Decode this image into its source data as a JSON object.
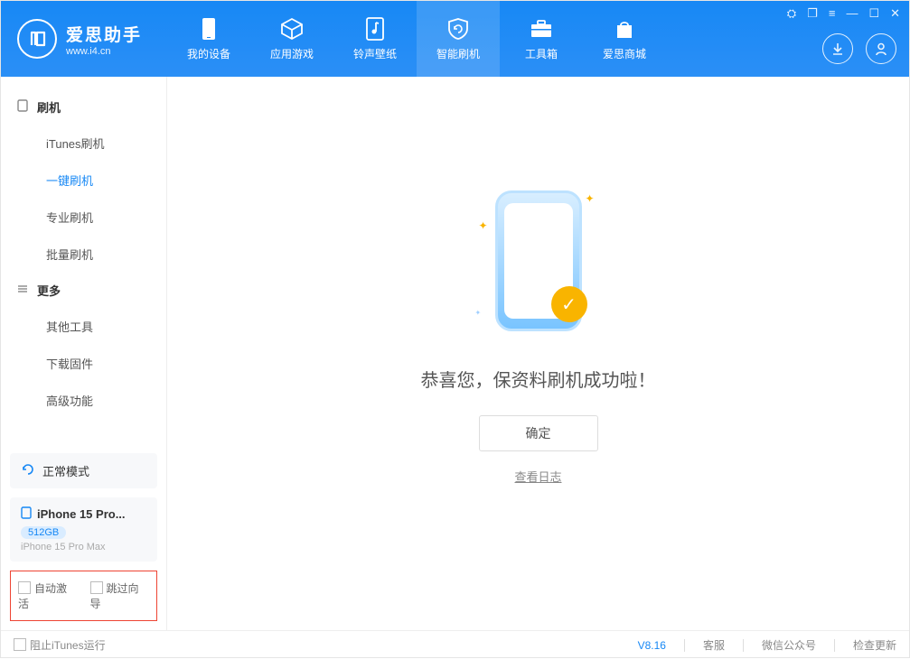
{
  "app": {
    "title_cn": "爱思助手",
    "title_en": "www.i4.cn"
  },
  "nav": {
    "items": [
      {
        "label": "我的设备"
      },
      {
        "label": "应用游戏"
      },
      {
        "label": "铃声壁纸"
      },
      {
        "label": "智能刷机"
      },
      {
        "label": "工具箱"
      },
      {
        "label": "爱思商城"
      }
    ],
    "active_index": 3
  },
  "win": {
    "gear": "⛭",
    "window": "❐",
    "menu": "≡",
    "min": "—",
    "max": "☐",
    "close": "✕"
  },
  "sidebar": {
    "groups": [
      {
        "title": "刷机",
        "items": [
          {
            "label": "iTunes刷机"
          },
          {
            "label": "一键刷机"
          },
          {
            "label": "专业刷机"
          },
          {
            "label": "批量刷机"
          }
        ],
        "active_index": 1
      },
      {
        "title": "更多",
        "items": [
          {
            "label": "其他工具"
          },
          {
            "label": "下载固件"
          },
          {
            "label": "高级功能"
          }
        ]
      }
    ],
    "mode_label": "正常模式",
    "device": {
      "name": "iPhone 15 Pro...",
      "storage": "512GB",
      "model": "iPhone 15 Pro Max"
    },
    "red_box": {
      "auto_activate": "自动激活",
      "skip_wizard": "跳过向导"
    }
  },
  "main": {
    "success_msg": "恭喜您，保资料刷机成功啦！",
    "ok_button": "确定",
    "log_link": "查看日志"
  },
  "footer": {
    "block_itunes": "阻止iTunes运行",
    "version": "V8.16",
    "links": {
      "support": "客服",
      "wechat": "微信公众号",
      "update": "检查更新"
    }
  }
}
